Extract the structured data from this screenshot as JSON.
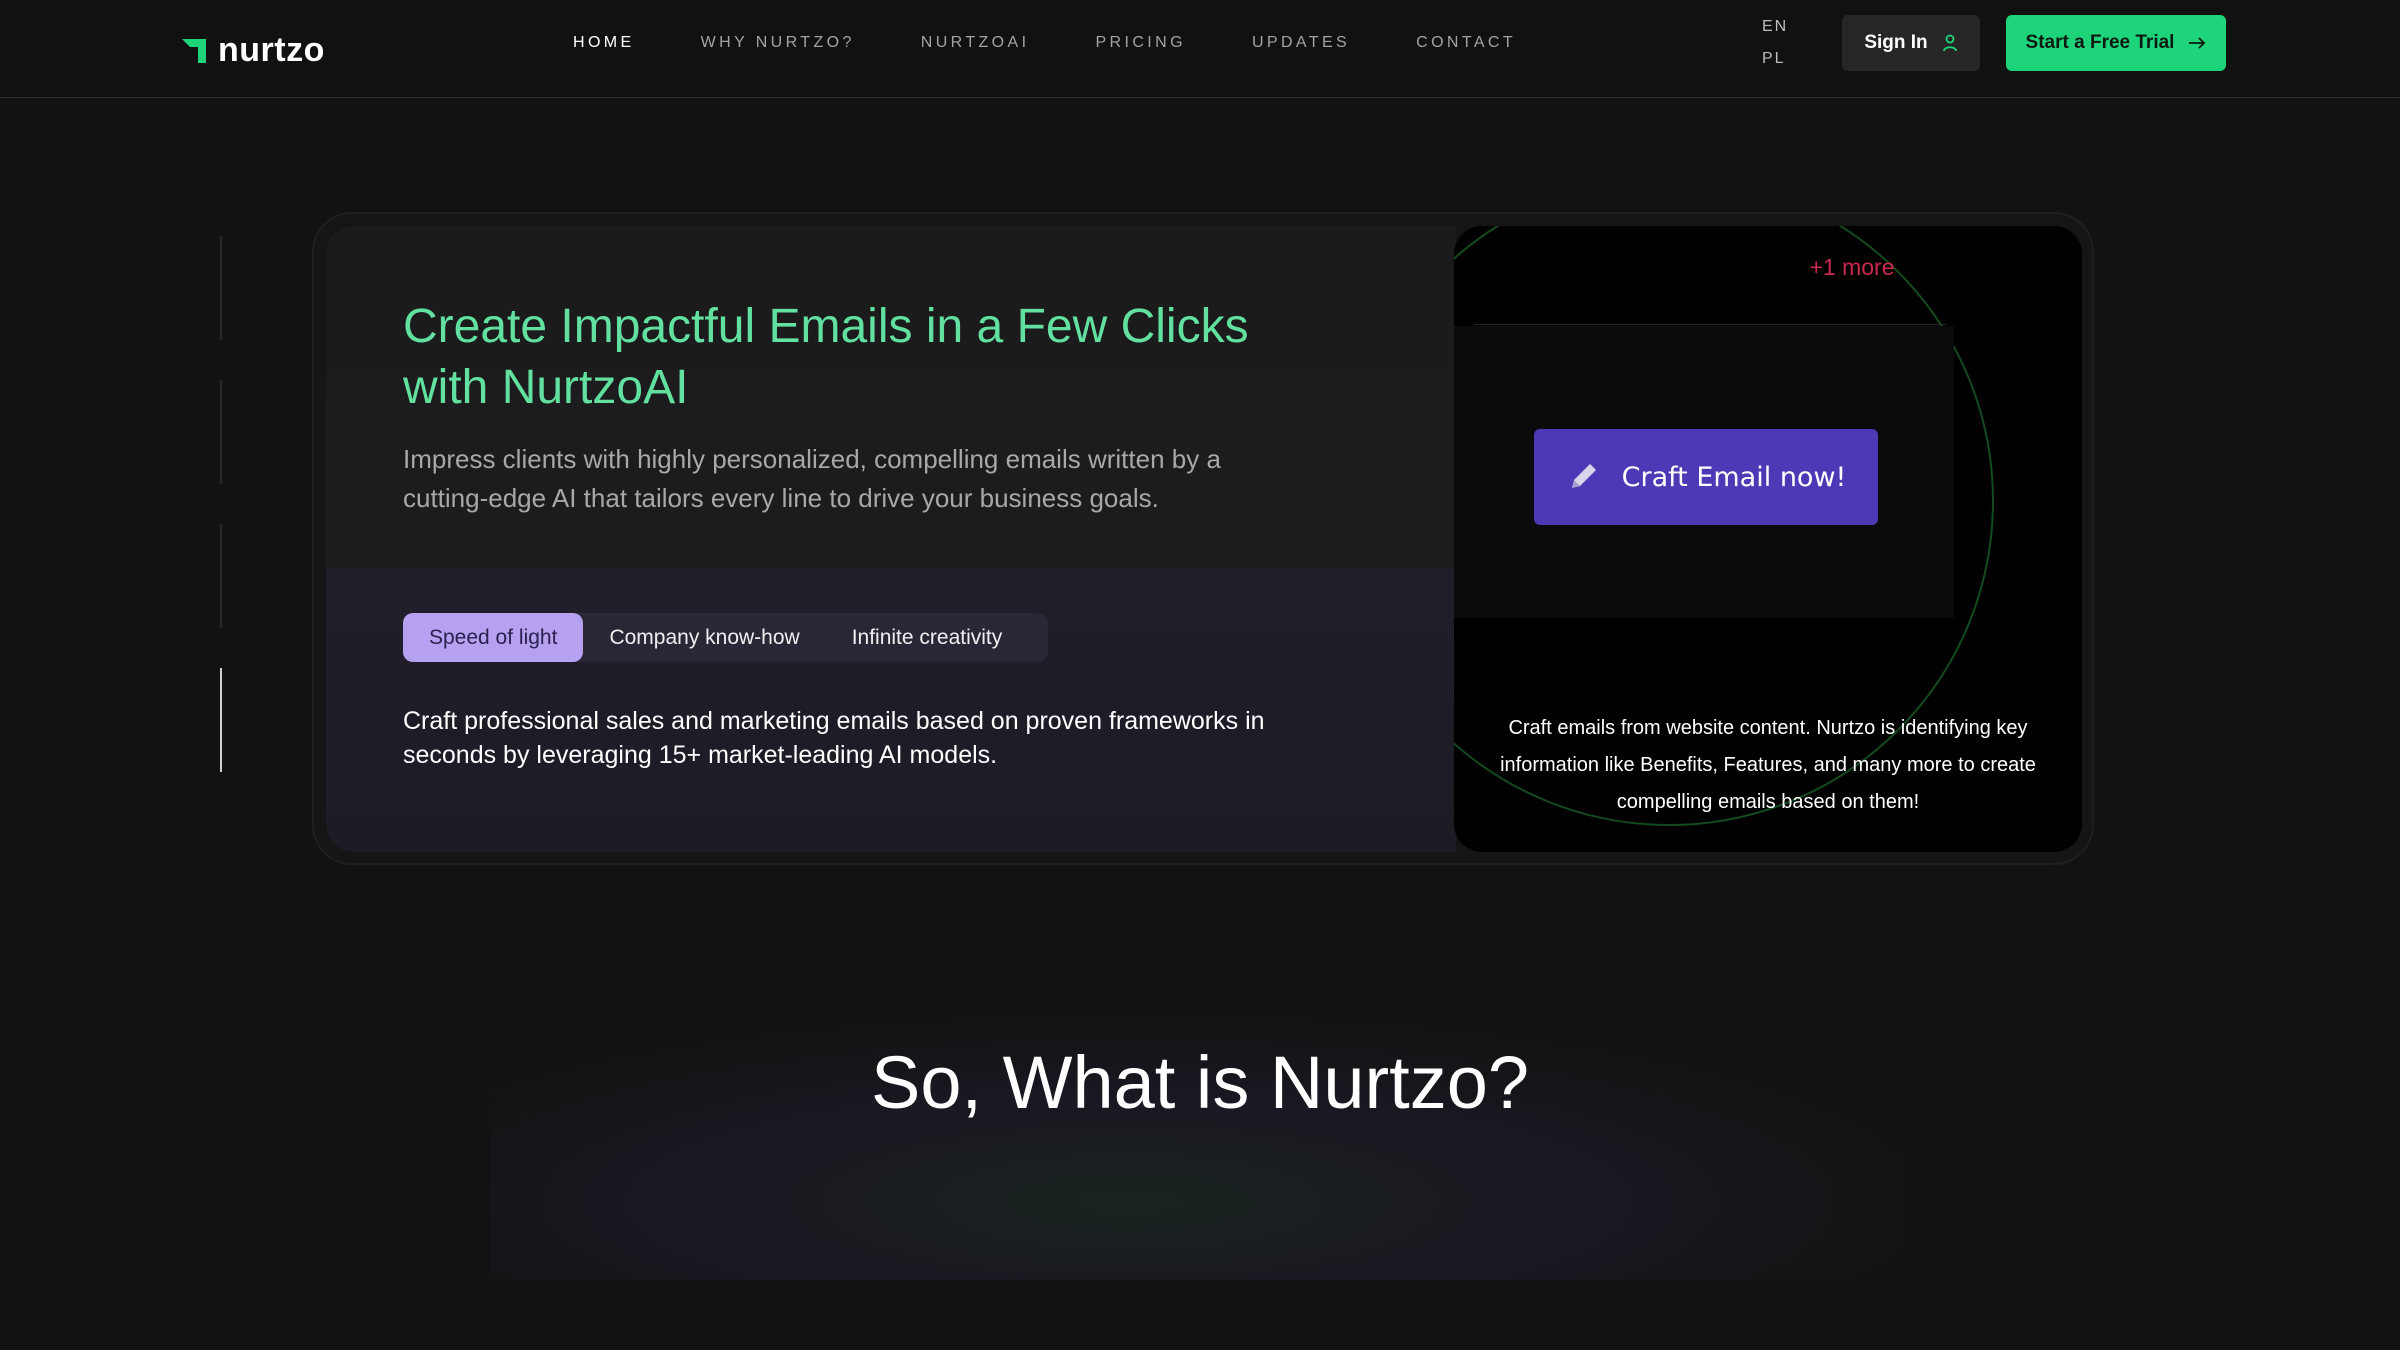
{
  "header": {
    "logo_text": "nurtzo",
    "nav": [
      {
        "label": "HOME",
        "active": true
      },
      {
        "label": "WHY NURTZO?",
        "active": false
      },
      {
        "label": "NURTZOAI",
        "active": false
      },
      {
        "label": "PRICING",
        "active": false
      },
      {
        "label": "UPDATES",
        "active": false
      },
      {
        "label": "CONTACT",
        "active": false
      }
    ],
    "languages": [
      "EN",
      "PL"
    ],
    "sign_in_label": "Sign In",
    "trial_label": "Start a Free Trial"
  },
  "hero": {
    "headline_line1": "Create Impactful Emails in a Few Clicks",
    "headline_line2": "with NurtzoAI",
    "subhead": "Impress clients with highly personalized, compelling emails written by a cutting-edge AI that tailors every line to drive your business goals.",
    "tabs": [
      {
        "label": "Speed of light",
        "active": true
      },
      {
        "label": "Company know-how",
        "active": false
      },
      {
        "label": "Infinite creativity",
        "active": false
      }
    ],
    "tab_description": "Craft professional sales and marketing emails based on proven frameworks in seconds by leveraging 15+ market-leading AI models."
  },
  "preview": {
    "more_label": "+1 more",
    "craft_button_label": "Craft Email now!",
    "description": "Craft emails from website content. Nurtzo is identifying key information like Benefits, Features, and many more to create compelling emails based on them!"
  },
  "section": {
    "title": "So, What is Nurtzo?"
  },
  "colors": {
    "brand_green": "#1ed47a",
    "headline_green": "#62e0a0",
    "tab_active": "#b6a0f0",
    "craft_purple": "#4f38b6",
    "more_red": "#c9294c"
  }
}
